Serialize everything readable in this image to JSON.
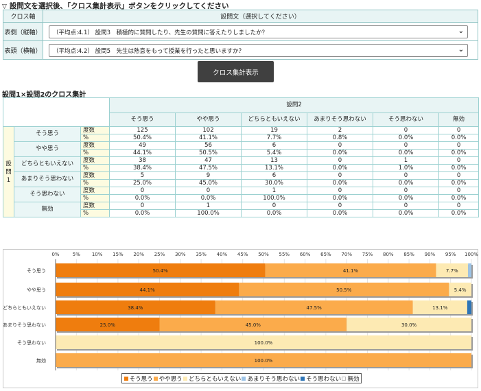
{
  "instruction": {
    "prefix": "▽",
    "text": "設問文を選択後、「クロス集計表示」ボタンをクリックしてください"
  },
  "selector": {
    "header_left": "クロス軸",
    "header_right": "設問文（選択してください）",
    "rows": [
      {
        "label": "表側（縦軸）",
        "value": "（平均点:4.1） 設問3　積極的に質問したり、先生の質問に答えたりしましたか？"
      },
      {
        "label": "表頭（横軸）",
        "value": "（平均点:4.2） 設問5　先生は熱意をもって授業を行ったと思いますか？"
      }
    ],
    "dropdown_arrow": "⌄"
  },
  "run_button": "クロス集計表示",
  "crosstab": {
    "title": "設問1×設問2のクロス集計",
    "col_question": "設問2",
    "row_question": "設問1",
    "columns": [
      "そう思う",
      "やや思う",
      "どちらともいえない",
      "あまりそう思わない",
      "そう思わない",
      "無効"
    ],
    "unit_count": "度数",
    "unit_pct": "%",
    "rows": [
      {
        "label": "そう思う",
        "counts": [
          "125",
          "102",
          "19",
          "2",
          "0",
          "0"
        ],
        "pcts": [
          "50.4%",
          "41.1%",
          "7.7%",
          "0.8%",
          "0.0%",
          "0.0%"
        ]
      },
      {
        "label": "やや思う",
        "counts": [
          "49",
          "56",
          "6",
          "0",
          "0",
          "0"
        ],
        "pcts": [
          "44.1%",
          "50.5%",
          "5.4%",
          "0.0%",
          "0.0%",
          "0.0%"
        ]
      },
      {
        "label": "どちらともいえない",
        "counts": [
          "38",
          "47",
          "13",
          "0",
          "1",
          "0"
        ],
        "pcts": [
          "38.4%",
          "47.5%",
          "13.1%",
          "0.0%",
          "1.0%",
          "0.0%"
        ]
      },
      {
        "label": "あまりそう思わない",
        "counts": [
          "5",
          "9",
          "6",
          "0",
          "0",
          "0"
        ],
        "pcts": [
          "25.0%",
          "45.0%",
          "30.0%",
          "0.0%",
          "0.0%",
          "0.0%"
        ]
      },
      {
        "label": "そう思わない",
        "counts": [
          "0",
          "0",
          "1",
          "0",
          "0",
          "0"
        ],
        "pcts": [
          "0.0%",
          "0.0%",
          "100.0%",
          "0.0%",
          "0.0%",
          "0.0%"
        ]
      },
      {
        "label": "無効",
        "counts": [
          "0",
          "1",
          "0",
          "0",
          "0",
          "0"
        ],
        "pcts": [
          "0.0%",
          "100.0%",
          "0.0%",
          "0.0%",
          "0.0%",
          "0.0%"
        ]
      }
    ]
  },
  "chart_data": {
    "type": "bar",
    "orientation": "horizontal",
    "stacked": true,
    "xlim": [
      0,
      100
    ],
    "x_ticks": [
      "0%",
      "5%",
      "10%",
      "15%",
      "20%",
      "25%",
      "30%",
      "35%",
      "40%",
      "45%",
      "50%",
      "55%",
      "60%",
      "65%",
      "70%",
      "75%",
      "80%",
      "85%",
      "90%",
      "95%",
      "100%"
    ],
    "categories": [
      "そう思う",
      "やや思う",
      "どちらともいえない",
      "あまりそう思わない",
      "そう思わない",
      "無効"
    ],
    "series": [
      {
        "name": "そう思う",
        "color": "#ef7d0e",
        "values": [
          50.4,
          44.1,
          38.4,
          25.0,
          0.0,
          0.0
        ]
      },
      {
        "name": "やや思う",
        "color": "#fbab4b",
        "values": [
          41.1,
          50.5,
          47.5,
          45.0,
          0.0,
          100.0
        ]
      },
      {
        "name": "どちらともいえない",
        "color": "#fdeab3",
        "values": [
          7.7,
          5.4,
          13.1,
          30.0,
          100.0,
          0.0
        ]
      },
      {
        "name": "あまりそう思わない",
        "color": "#9cc3e6",
        "values": [
          0.8,
          0.0,
          0.0,
          0.0,
          0.0,
          0.0
        ]
      },
      {
        "name": "そう思わない",
        "color": "#2e75b6",
        "values": [
          0.0,
          0.0,
          1.0,
          0.0,
          0.0,
          0.0
        ]
      },
      {
        "name": "無効",
        "color": "#ffffff",
        "values": [
          0.0,
          0.0,
          0.0,
          0.0,
          0.0,
          0.0
        ]
      }
    ],
    "data_labels": [
      [
        "50.4%",
        "41.1%",
        "7.7%",
        "",
        "",
        ""
      ],
      [
        "44.1%",
        "50.5%",
        "5.4%",
        "",
        "",
        ""
      ],
      [
        "38.4%",
        "47.5%",
        "13.1%",
        "",
        "",
        ""
      ],
      [
        "25.0%",
        "45.0%",
        "30.0%",
        "",
        "",
        ""
      ],
      [
        "",
        "",
        "100.0%",
        "",
        "",
        ""
      ],
      [
        "",
        "100.0%",
        "",
        "",
        "",
        ""
      ]
    ],
    "legend_placement": "bottom-center"
  }
}
